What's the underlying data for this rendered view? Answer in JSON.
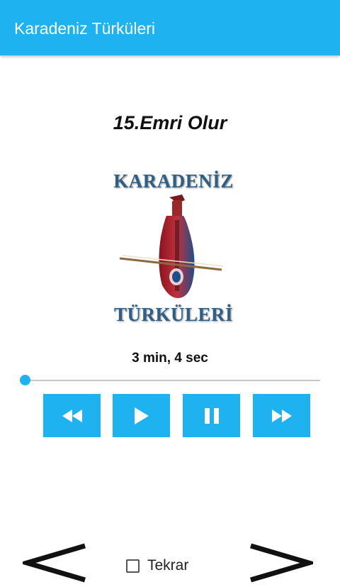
{
  "app": {
    "title": "Karadeniz Türküleri",
    "accent_color": "#1fb2f0"
  },
  "player": {
    "track_title": "15.Emri Olur",
    "duration_text": "3 min, 4 sec",
    "progress": 0.0,
    "logo": {
      "top_text": "KARADENİZ",
      "bottom_text": "TÜRKÜLERİ",
      "image": "kemence-instrument"
    },
    "controls": [
      {
        "name": "rewind-button",
        "icon": "rewind-icon"
      },
      {
        "name": "play-button",
        "icon": "play-icon"
      },
      {
        "name": "pause-button",
        "icon": "pause-icon"
      },
      {
        "name": "fast-forward-button",
        "icon": "fast-forward-icon"
      }
    ]
  },
  "footer": {
    "prev_icon": "chevron-left-icon",
    "next_icon": "chevron-right-icon",
    "repeat_label": "Tekrar",
    "repeat_checked": false
  }
}
